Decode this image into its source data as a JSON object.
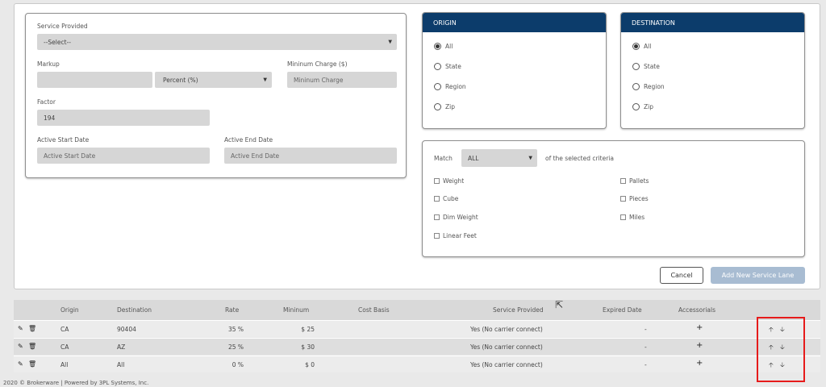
{
  "form": {
    "service_provided_label": "Service Provided",
    "service_provided_value": "--Select--",
    "markup_label": "Markup",
    "markup_type_value": "Percent (%)",
    "minimum_charge_label": "Mininum Charge ($)",
    "minimum_charge_placeholder": "Mininum Charge",
    "factor_label": "Factor",
    "factor_value": "194",
    "active_start_label": "Active Start Date",
    "active_start_placeholder": "Active Start Date",
    "active_end_label": "Active End Date",
    "active_end_placeholder": "Active End Date"
  },
  "origin": {
    "title": "ORIGIN",
    "options": [
      "All",
      "State",
      "Region",
      "Zip"
    ],
    "selected": "All"
  },
  "destination": {
    "title": "DESTINATION",
    "options": [
      "All",
      "State",
      "Region",
      "Zip"
    ],
    "selected": "All"
  },
  "criteria": {
    "match_label": "Match",
    "match_value": "ALL",
    "suffix": "of the selected criteria",
    "left": [
      "Weight",
      "Cube",
      "Dim Weight",
      "Linear Feet"
    ],
    "right": [
      "Pallets",
      "Pieces",
      "Miles"
    ]
  },
  "buttons": {
    "cancel": "Cancel",
    "add": "Add New Service Lane"
  },
  "table": {
    "headers": [
      "Origin",
      "Destination",
      "Rate",
      "Mininum",
      "Cost Basis",
      "Service Provided",
      "Expired Date",
      "Accessorials"
    ],
    "rows": [
      {
        "origin": "CA",
        "destination": "90404",
        "rate": "35 %",
        "minimum": "$ 25",
        "service": "Yes (No carrier connect)",
        "expired": "-",
        "accessorials": "+"
      },
      {
        "origin": "CA",
        "destination": "AZ",
        "rate": "25 %",
        "minimum": "$ 30",
        "service": "Yes (No carrier connect)",
        "expired": "-",
        "accessorials": "+"
      },
      {
        "origin": "All",
        "destination": "All",
        "rate": "0 %",
        "minimum": "$ 0",
        "service": "Yes (No carrier connect)",
        "expired": "-",
        "accessorials": "+"
      }
    ]
  },
  "footer": "2020 © Brokerware | Powered by 3PL Systems, Inc.",
  "colors": {
    "header_blue": "#0c3c6b",
    "highlight_red": "#e61b1b",
    "add_button": "#a8bcd2"
  }
}
